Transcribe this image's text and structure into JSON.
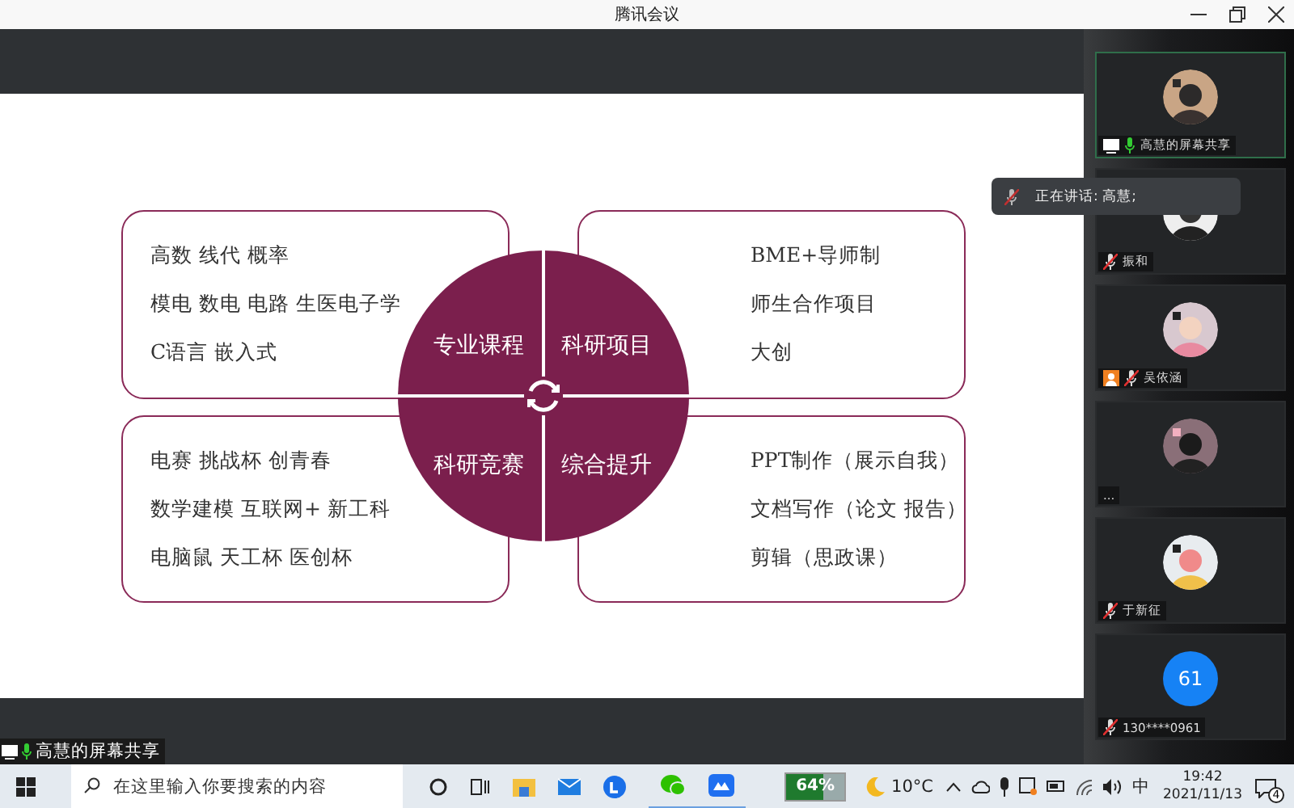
{
  "window": {
    "title": "腾讯会议"
  },
  "slide": {
    "boxes": [
      {
        "lines": [
          "高数  线代  概率",
          "模电  数电  电路  生医电子学",
          "C语言  嵌入式"
        ]
      },
      {
        "lines": [
          "BME+导师制",
          "师生合作项目",
          "大创"
        ]
      },
      {
        "lines": [
          "电赛  挑战杯  创青春",
          "数学建模  互联网+  新工科",
          "电脑鼠  天工杯  医创杯"
        ]
      },
      {
        "lines": [
          "PPT制作（展示自我）",
          "文档写作（论文  报告）",
          "剪辑（思政课）"
        ]
      }
    ],
    "quadrants": [
      "专业课程",
      "科研项目",
      "科研竞赛",
      "综合提升"
    ]
  },
  "speaking": {
    "text": "正在讲话: 高慧;"
  },
  "participants": [
    {
      "name": "高慧的屏幕共享",
      "muted": false,
      "sharing": true,
      "selected": true
    },
    {
      "name": "振和",
      "muted": true,
      "selected": false
    },
    {
      "name": "吴依涵",
      "muted": true,
      "guest": true,
      "selected": false
    },
    {
      "name": "...",
      "selected": false
    },
    {
      "name": "于新征",
      "muted": true,
      "selected": false
    },
    {
      "name": "130****0961",
      "muted": true,
      "selected": false,
      "initials": "61"
    }
  ],
  "share_label": {
    "text": "高慧的屏幕共享"
  },
  "taskbar": {
    "search_placeholder": "在这里输入你要搜索的内容",
    "battery": {
      "text": "64%",
      "level": 0.64
    },
    "weather": "10°C",
    "ime": "中",
    "time": "19:42",
    "date": "2021/11/13",
    "notifications": "4"
  }
}
